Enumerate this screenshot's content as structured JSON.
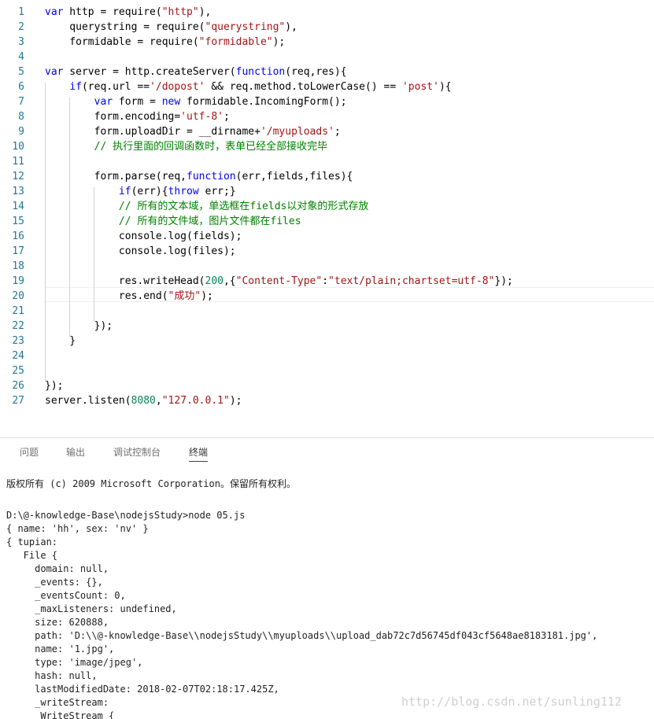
{
  "editor": {
    "line_numbers": [
      "1",
      "2",
      "3",
      "4",
      "5",
      "6",
      "7",
      "8",
      "9",
      "10",
      "11",
      "12",
      "13",
      "14",
      "15",
      "16",
      "17",
      "18",
      "19",
      "20",
      "21",
      "22",
      "23",
      "24",
      "25",
      "26",
      "27"
    ],
    "lines": [
      [
        {
          "t": "var",
          "c": "k"
        },
        {
          "t": " http = require("
        },
        {
          "t": "\"http\"",
          "c": "s"
        },
        {
          "t": "),"
        }
      ],
      [
        {
          "t": "    querystring = require("
        },
        {
          "t": "\"querystring\"",
          "c": "s"
        },
        {
          "t": "),"
        }
      ],
      [
        {
          "t": "    formidable = require("
        },
        {
          "t": "\"formidable\"",
          "c": "s"
        },
        {
          "t": ");"
        }
      ],
      [],
      [
        {
          "t": "var",
          "c": "k"
        },
        {
          "t": " server = http.createServer("
        },
        {
          "t": "function",
          "c": "k"
        },
        {
          "t": "(req,res){"
        }
      ],
      [
        {
          "t": "    "
        },
        {
          "t": "if",
          "c": "k"
        },
        {
          "t": "(req.url =="
        },
        {
          "t": "'/dopost'",
          "c": "s"
        },
        {
          "t": " && req.method.toLowerCase() == "
        },
        {
          "t": "'post'",
          "c": "s"
        },
        {
          "t": "){"
        }
      ],
      [
        {
          "t": "        "
        },
        {
          "t": "var",
          "c": "k"
        },
        {
          "t": " form = "
        },
        {
          "t": "new",
          "c": "k"
        },
        {
          "t": " formidable.IncomingForm();"
        }
      ],
      [
        {
          "t": "        form.encoding="
        },
        {
          "t": "'utf-8'",
          "c": "s"
        },
        {
          "t": ";"
        }
      ],
      [
        {
          "t": "        form.uploadDir = __dirname+"
        },
        {
          "t": "'/myuploads'",
          "c": "s"
        },
        {
          "t": ";"
        }
      ],
      [
        {
          "t": "        "
        },
        {
          "t": "// 执行里面的回调函数时，表单已经全部接收完毕",
          "c": "c"
        }
      ],
      [],
      [
        {
          "t": "        form.parse(req,"
        },
        {
          "t": "function",
          "c": "k"
        },
        {
          "t": "(err,fields,files){"
        }
      ],
      [
        {
          "t": "            "
        },
        {
          "t": "if",
          "c": "k"
        },
        {
          "t": "(err){"
        },
        {
          "t": "throw",
          "c": "k"
        },
        {
          "t": " err;}"
        }
      ],
      [
        {
          "t": "            "
        },
        {
          "t": "// 所有的文本域，单选框在fields以对象的形式存放",
          "c": "c"
        }
      ],
      [
        {
          "t": "            "
        },
        {
          "t": "// 所有的文件域，图片文件都在files",
          "c": "c"
        }
      ],
      [
        {
          "t": "            console.log(fields);"
        }
      ],
      [
        {
          "t": "            console.log(files);"
        }
      ],
      [],
      [
        {
          "t": "            res.writeHead("
        },
        {
          "t": "200",
          "c": "n"
        },
        {
          "t": ",{"
        },
        {
          "t": "\"Content-Type\"",
          "c": "s"
        },
        {
          "t": ":"
        },
        {
          "t": "\"text/plain;chartset=utf-8\"",
          "c": "s"
        },
        {
          "t": "});"
        }
      ],
      [
        {
          "t": "            res.end("
        },
        {
          "t": "\"成功\"",
          "c": "s"
        },
        {
          "t": ");"
        }
      ],
      [],
      [
        {
          "t": "        });"
        }
      ],
      [
        {
          "t": "    }"
        }
      ],
      [],
      [],
      [
        {
          "t": "});"
        }
      ],
      [
        {
          "t": "server.listen("
        },
        {
          "t": "8080",
          "c": "n"
        },
        {
          "t": ","
        },
        {
          "t": "\"127.0.0.1\"",
          "c": "s"
        },
        {
          "t": ");"
        }
      ]
    ]
  },
  "panel": {
    "tabs": [
      {
        "label": "问题",
        "active": false
      },
      {
        "label": "输出",
        "active": false
      },
      {
        "label": "调试控制台",
        "active": false
      },
      {
        "label": "终端",
        "active": true
      }
    ]
  },
  "terminal": {
    "lines": [
      "版权所有 (c) 2009 Microsoft Corporation。保留所有权利。",
      "",
      "D:\\@-knowledge-Base\\nodejsStudy>node 05.js",
      "{ name: 'hh', sex: 'nv' }",
      "{ tupian:",
      "   File {",
      "     domain: null,",
      "     _events: {},",
      "     _eventsCount: 0,",
      "     _maxListeners: undefined,",
      "     size: 620888,",
      "     path: 'D:\\\\@-knowledge-Base\\\\nodejsStudy\\\\myuploads\\\\upload_dab72c7d56745df043cf5648ae8183181.jpg',",
      "     name: '1.jpg',",
      "     type: 'image/jpeg',",
      "     hash: null,",
      "     lastModifiedDate: 2018-02-07T02:18:17.425Z,",
      "     _writeStream:",
      "      WriteStream {"
    ]
  },
  "watermark": "http://blog.csdn.net/sunling112"
}
